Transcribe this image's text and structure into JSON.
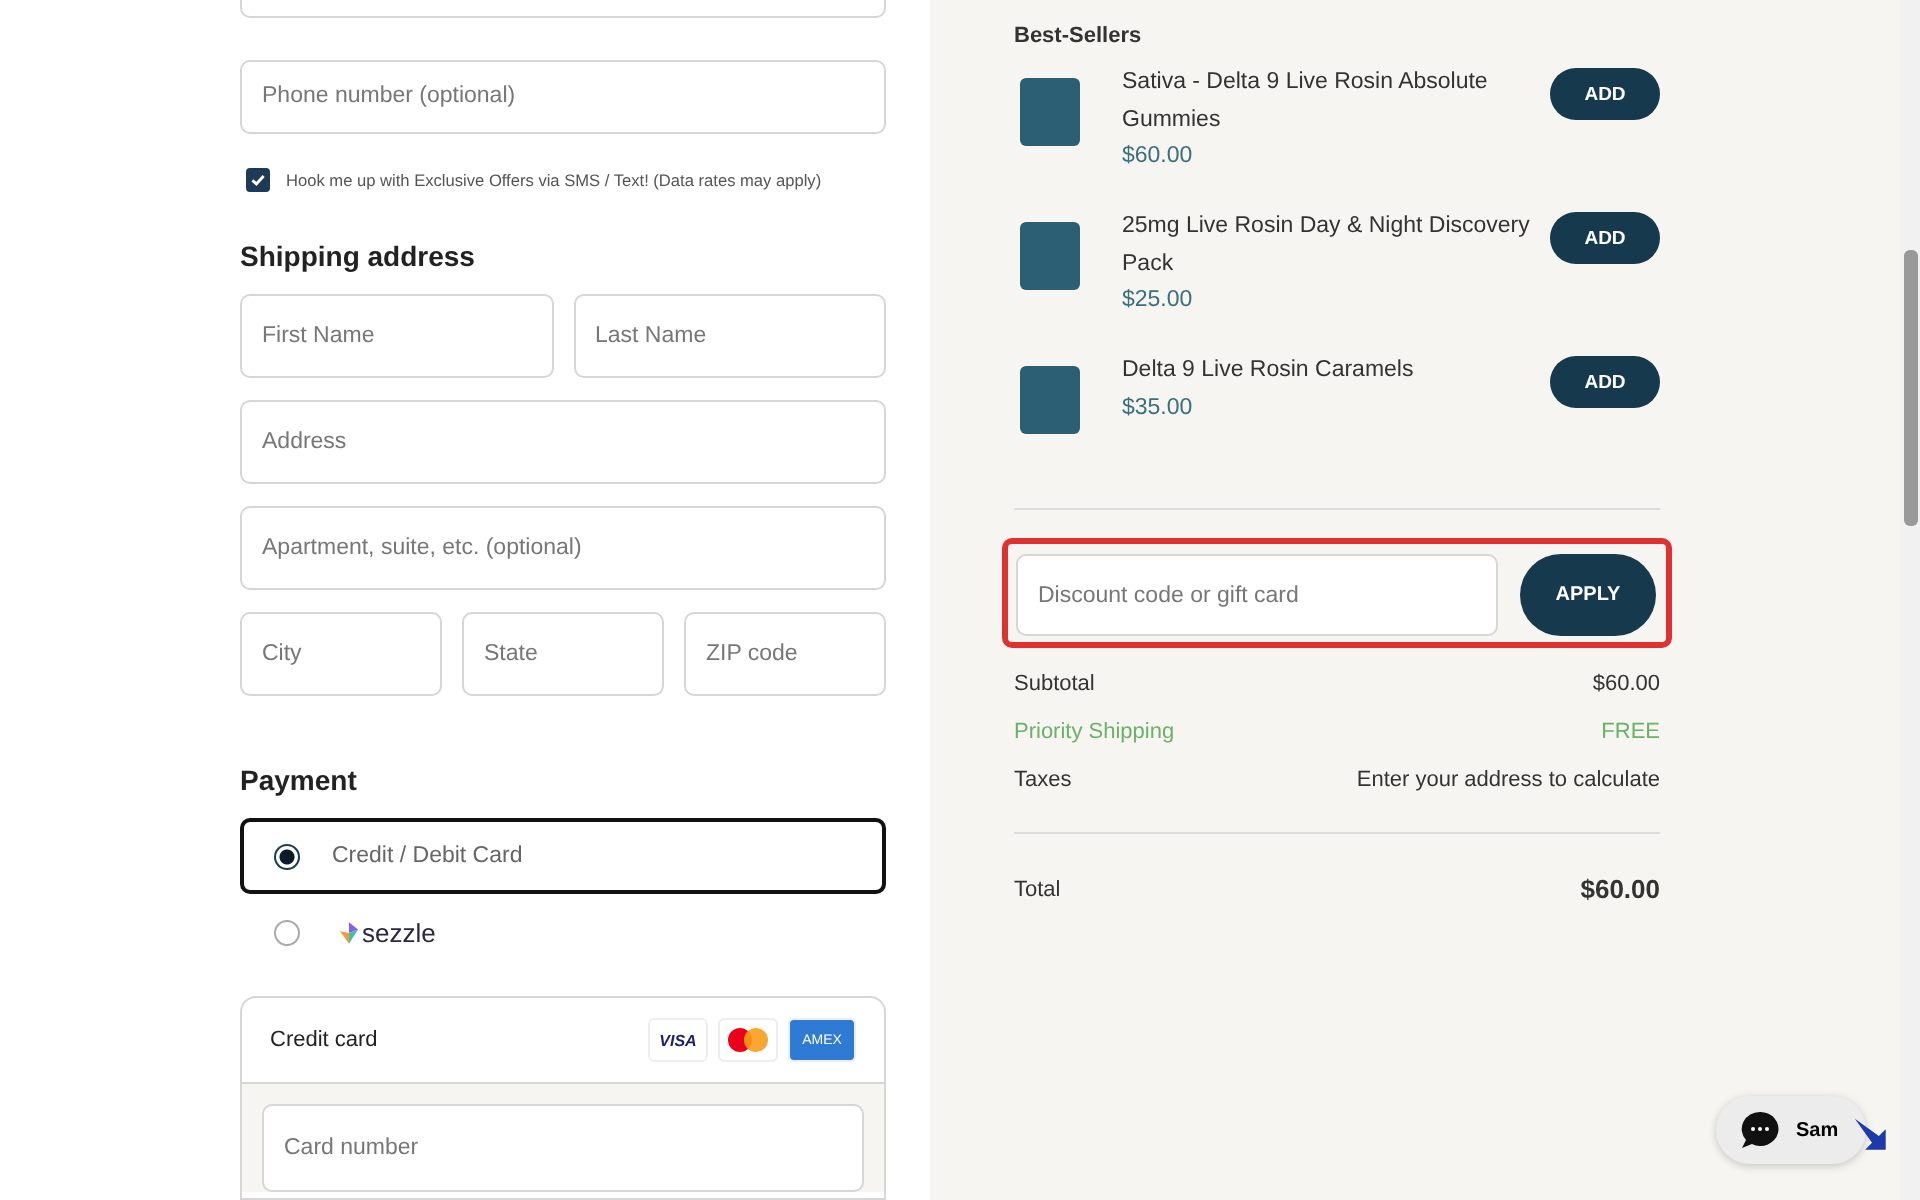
{
  "contact": {
    "phone_placeholder": "Phone number (optional)",
    "sms_optin": {
      "label": "Hook me up with Exclusive Offers via SMS / Text! (Data rates may apply)",
      "checked": true
    }
  },
  "shipping": {
    "title": "Shipping address",
    "rows": [
      [
        {
          "placeholder": "First Name"
        },
        {
          "placeholder": "Last Name"
        }
      ],
      [
        {
          "placeholder": "Address"
        }
      ],
      [
        {
          "placeholder": "Apartment, suite, etc. (optional)"
        }
      ],
      [
        {
          "placeholder": "City"
        },
        {
          "placeholder": "State"
        },
        {
          "placeholder": "ZIP code"
        }
      ]
    ]
  },
  "payment": {
    "title": "Payment",
    "options": [
      {
        "kind": "text",
        "label": "Credit / Debit Card",
        "selected": true
      },
      {
        "kind": "sezzle",
        "label": "sezzle",
        "selected": false
      }
    ],
    "card": {
      "title": "Credit card",
      "brands": [
        {
          "kind": "visa",
          "label": "VISA"
        },
        {
          "kind": "mastercard"
        },
        {
          "kind": "amex",
          "label": "AMEX"
        }
      ],
      "card_number_placeholder": "Card number"
    }
  },
  "best_sellers": {
    "title": "Best-Sellers",
    "products": [
      {
        "name": "Sativa - Delta 9 Live Rosin Absolute Gummies",
        "price": "$60.00",
        "button": "ADD"
      },
      {
        "name": "25mg Live Rosin Day & Night Discovery Pack",
        "price": "$25.00",
        "button": "ADD"
      },
      {
        "name": "Delta 9 Live Rosin Caramels",
        "price": "$35.00",
        "button": "ADD"
      }
    ]
  },
  "discount": {
    "placeholder": "Discount code or gift card",
    "button": "APPLY"
  },
  "summary": [
    {
      "label": "Subtotal",
      "value": "$60.00",
      "kind": "normal"
    },
    {
      "label": "Priority Shipping",
      "value": "FREE",
      "kind": "free"
    },
    {
      "label": "Taxes",
      "value": "Enter your address to calculate",
      "kind": "normal"
    }
  ],
  "total": {
    "label": "Total",
    "value": "$60.00"
  },
  "chat": {
    "label": "Sam"
  }
}
